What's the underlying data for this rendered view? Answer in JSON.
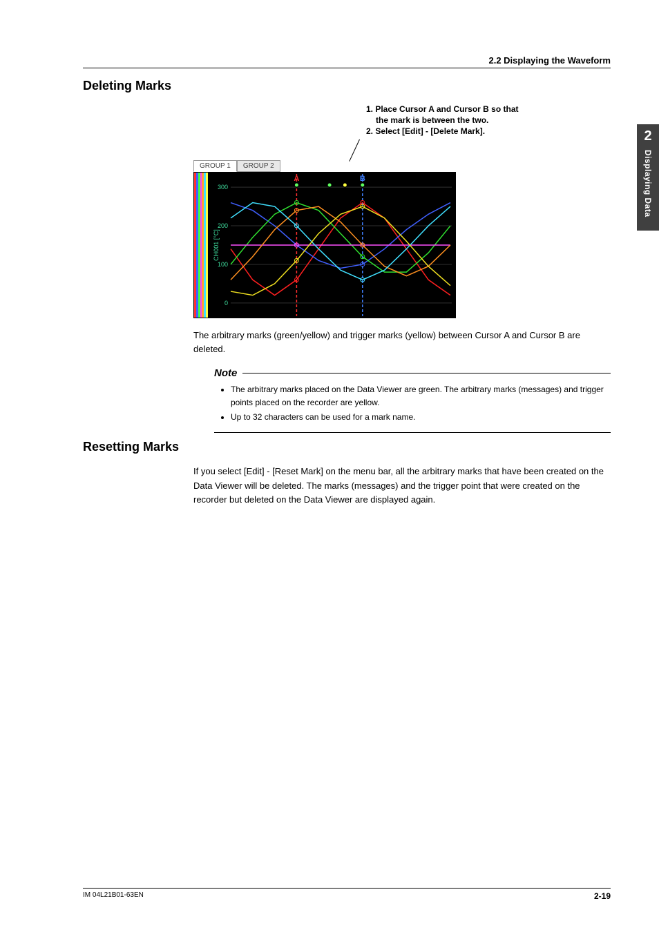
{
  "header": {
    "section": "2.2  Displaying the Waveform"
  },
  "side_tab": {
    "num": "2",
    "label": "Displaying Data"
  },
  "sections": {
    "deleting_title": "Deleting Marks",
    "instructions": {
      "line1": "1. Place Cursor A and Cursor B so that",
      "line1b": "the mark is between the two.",
      "line2": "2. Select [Edit] - [Delete Mark]."
    },
    "deleting_body": "The arbitrary marks (green/yellow) and trigger marks (yellow) between Cursor A and Cursor B are deleted.",
    "note_title": "Note",
    "note_items": [
      "The arbitrary marks placed on the Data Viewer are green. The arbitrary marks (messages) and trigger points placed on the recorder are yellow.",
      "Up to 32 characters can be used for a mark name."
    ],
    "resetting_title": "Resetting Marks",
    "resetting_body": "If you select [Edit] - [Reset Mark] on the menu bar, all the arbitrary marks that have been created on the Data Viewer will be deleted. The marks (messages) and the trigger point that were created on the recorder but deleted on the Data Viewer are displayed again."
  },
  "chart": {
    "tabs": [
      "GROUP 1",
      "GROUP 2"
    ],
    "active_tab": 0,
    "y_axis_label": "CH001 [°C]",
    "y_ticks": [
      "300",
      "200",
      "100",
      "0"
    ],
    "cursor_labels": [
      "A",
      "B"
    ],
    "bar_colors": [
      "#ff3030",
      "#4060ff",
      "#40ff40",
      "#ff40ff",
      "#ffa030",
      "#40e0ff",
      "#ffff40"
    ]
  },
  "chart_data": {
    "type": "line",
    "title": "",
    "xlabel": "",
    "ylabel": "CH001 [°C]",
    "ylim": [
      -20,
      320
    ],
    "x": [
      0,
      35,
      70,
      105,
      140,
      175,
      210,
      245,
      280,
      315,
      350
    ],
    "series": [
      {
        "name": "red",
        "color": "#ff2020",
        "values": [
          140,
          60,
          20,
          60,
          140,
          220,
          260,
          220,
          140,
          60,
          20
        ]
      },
      {
        "name": "blue",
        "color": "#4060ff",
        "values": [
          260,
          240,
          200,
          150,
          110,
          90,
          100,
          140,
          190,
          230,
          260
        ]
      },
      {
        "name": "green",
        "color": "#30e030",
        "values": [
          100,
          170,
          230,
          260,
          240,
          180,
          120,
          80,
          80,
          130,
          200
        ]
      },
      {
        "name": "magenta",
        "color": "#ff50ff",
        "values": [
          150,
          150,
          150,
          150,
          150,
          150,
          150,
          150,
          150,
          150,
          150
        ]
      },
      {
        "name": "orange",
        "color": "#ff9020",
        "values": [
          60,
          120,
          190,
          240,
          250,
          210,
          150,
          95,
          70,
          95,
          150
        ]
      },
      {
        "name": "cyan",
        "color": "#40e0ff",
        "values": [
          220,
          260,
          250,
          200,
          140,
          85,
          60,
          85,
          140,
          200,
          250
        ]
      },
      {
        "name": "yellow",
        "color": "#f0e020",
        "values": [
          30,
          20,
          50,
          110,
          180,
          230,
          250,
          220,
          160,
          95,
          45
        ]
      }
    ],
    "cursors": [
      {
        "name": "A",
        "x_index": 3,
        "color": "#ff3030"
      },
      {
        "name": "B",
        "x_index": 6,
        "color": "#4080ff"
      }
    ],
    "marks": [
      {
        "x_index": 3,
        "color": "#60ff60"
      },
      {
        "x_index": 4.5,
        "color": "#60ff60"
      },
      {
        "x_index": 5.2,
        "color": "#ffff40"
      },
      {
        "x_index": 6,
        "color": "#60ff60"
      }
    ]
  },
  "footer": {
    "left": "IM 04L21B01-63EN",
    "right": "2-19"
  }
}
